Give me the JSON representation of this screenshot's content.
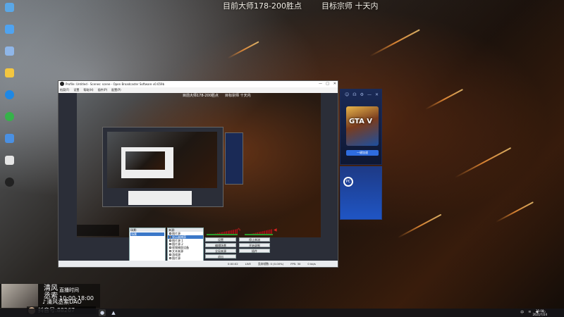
{
  "overlay": {
    "current_points": "目前大师178-200胜点",
    "goal": "目标宗师 十天内"
  },
  "desktop_icons": [
    {
      "name": "recycle-bin-icon",
      "color": "#5aa7e6"
    },
    {
      "name": "this-pc-icon",
      "color": "#4fa3f0"
    },
    {
      "name": "network-icon",
      "color": "#8fb6e8"
    },
    {
      "name": "folder-icon",
      "color": "#f3c640"
    },
    {
      "name": "app-s-icon",
      "color": "#1e88e5"
    },
    {
      "name": "browser-icon",
      "color": "#36b24a"
    },
    {
      "name": "launcher-icon",
      "color": "#4a90e2"
    },
    {
      "name": "file-icon",
      "color": "#e5e5e5"
    },
    {
      "name": "qq-icon",
      "color": "#222222"
    }
  ],
  "obs": {
    "title": "Profile: Untitled - Scenes: scene - Open Broadcaster Software v0.659b",
    "menu": [
      "档案(F)",
      "设置",
      "帮助(H)",
      "插件(P)",
      "配置(P)"
    ],
    "preview_overlay_left": "目前大师178-200胜点",
    "preview_overlay_right": "目标宗师 十天内",
    "scenes_header": "场景:",
    "scene_selected": "场景",
    "sources_header": "来源:",
    "sources": [
      "图片源",
      "显示器捕获",
      "图片源 1",
      "图片源 2",
      "视频捕获设备",
      "文本来源",
      "游戏源",
      "图片源"
    ],
    "buttons": {
      "settings": "设置",
      "stop_stream": "停止串流",
      "edit_scene": "编辑场景",
      "start_recording": "开始录制",
      "global_sources": "全局来源",
      "plugins": "插件",
      "exit": "退出"
    },
    "status": {
      "fps": "FPS: 30",
      "time": "0:00:02",
      "live": "LIVE",
      "bitrate": "0 kb/s",
      "dropped": "丢弃帧数: 0 (0.00%)"
    }
  },
  "launcher": {
    "button": "一键加速",
    "game_title": "GTA V"
  },
  "stream": {
    "name_line1": "清风",
    "name_line2": "丞索",
    "time_label": "直播时间",
    "time": "10:00-18:00",
    "douyin": "清风丞索DAO",
    "viewer": "抖音号:88267"
  },
  "taskbar": {
    "time": "15:08",
    "date": "2021/7/24",
    "lang": "中"
  }
}
